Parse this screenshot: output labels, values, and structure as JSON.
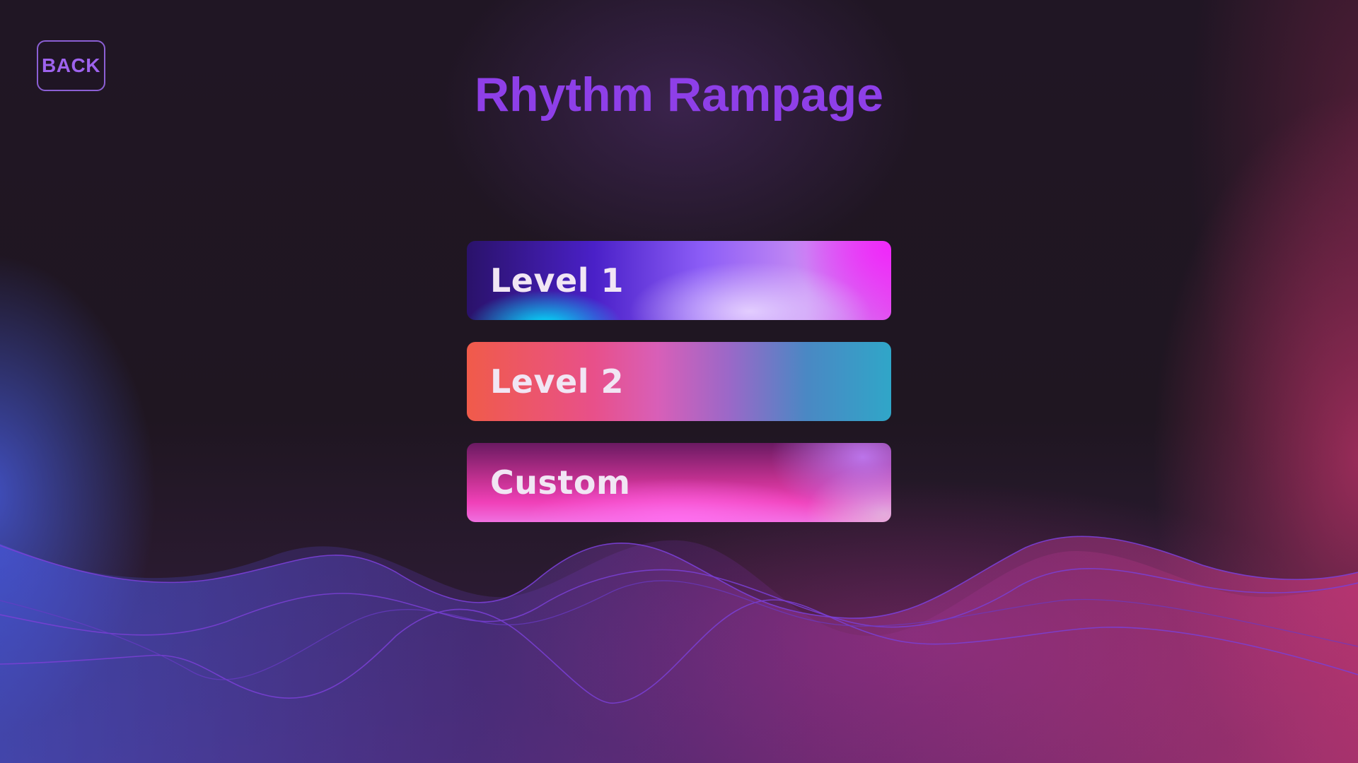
{
  "header": {
    "back_label": "BACK",
    "title": "Rhythm Rampage"
  },
  "menu": {
    "levels": [
      {
        "label": "Level 1"
      },
      {
        "label": "Level 2"
      },
      {
        "label": "Custom"
      }
    ]
  },
  "colors": {
    "title": "#8e3fe8",
    "back_text": "#9e63ee",
    "back_border": "#8b5fd4",
    "background": "#1e1622",
    "wave_stroke": "#7a3fd6",
    "accent_blue": "#4a5ae0",
    "accent_pink": "#e0408a"
  }
}
